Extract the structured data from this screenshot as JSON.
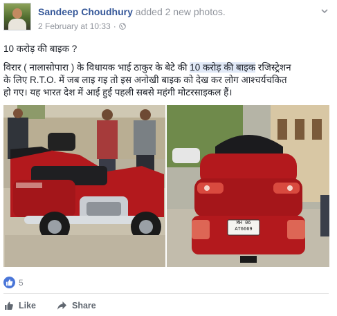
{
  "post": {
    "author": "Sandeep Choudhury",
    "action": " added 2 new photos.",
    "date": "2 February at 10:33",
    "separator": " · ",
    "privacy_icon": "globe-icon",
    "menu_icon": "chevron-down-icon"
  },
  "body": {
    "line1": "10 करोड़ की बाइक ?",
    "line2_pre": "विरार ( नालासोपारा ) के विधायक भाई ठाकुर के बेटे की ",
    "line2_highlight": "10 करोड़ की बाइक",
    "line2_post": " रजिस्ट्रेशन",
    "line3": "के लिए R.T.O. में जब लाइ गइ तो इस अनोखी बाइक को देख कर लोग आश्चर्यचकित",
    "line4": "हो गए। यह भारत देश में आई हुई पहली सबसे महंगी मोटरसाइकल हैं।"
  },
  "photos": {
    "plate_line1": "MH 06",
    "plate_line2": "AT6669"
  },
  "reactions": {
    "icon": "thumbs-up-icon",
    "count": "5"
  },
  "actions": {
    "like_label": "Like",
    "share_label": "Share"
  },
  "colors": {
    "link": "#365899",
    "meta": "#90949c",
    "bike_red": "#b3191d",
    "like_blue": "#4a76d8"
  }
}
